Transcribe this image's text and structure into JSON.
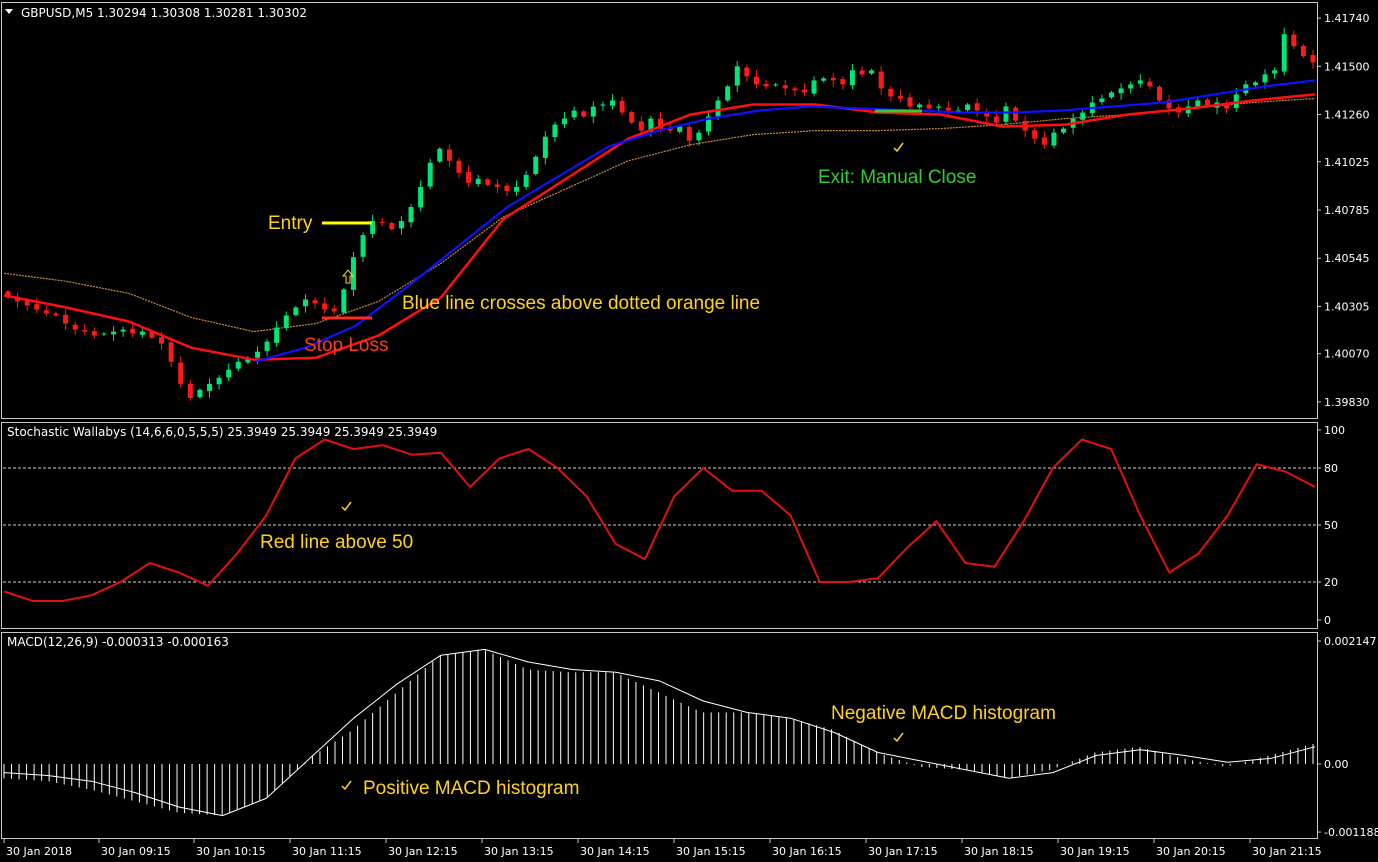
{
  "colors": {
    "background": "#000000",
    "frame": "#c8c8c8",
    "bull_candle": "#00e676",
    "bear_candle": "#ff1a1a",
    "ema_blue": "#1010ff",
    "ema_red": "#ff0f0f",
    "ema_orange_dotted": "#d08a3a",
    "stoch_line": "#e01010",
    "macd_hist": "#ffffff",
    "macd_signal": "#ffffff",
    "annotation_yellow": "#ffd21f",
    "annotation_red": "#ff3b1a",
    "annotation_green": "#33cc33"
  },
  "price_panel": {
    "header": "GBPUSD,M5  1.30294 1.30308 1.30281 1.30302",
    "menu_icon": "triangle-down-icon",
    "y_ticks": [
      "1.41740",
      "1.41500",
      "1.41260",
      "1.41025",
      "1.40785",
      "1.40545",
      "1.40305",
      "1.40070",
      "1.39830"
    ],
    "annotations": {
      "entry": "Entry",
      "cross": "Blue line crosses above dotted orange line",
      "stop": "Stop Loss",
      "exit": "Exit: Manual Close"
    }
  },
  "stoch_panel": {
    "header": "Stochastic Wallabys (14,6,6,0,5,5,5) 25.3949 25.3949 25.3949 25.3949",
    "y_ticks": [
      "100",
      "80",
      "50",
      "20",
      "0"
    ],
    "annotation": "Red line above 50"
  },
  "macd_panel": {
    "header": "MACD(12,26,9) -0.000313 -0.000163",
    "y_ticks": [
      "0.002147",
      "0.00",
      "-0.001188"
    ],
    "annotations": {
      "negative": "Negative MACD histogram",
      "positive": "Positive MACD histogram"
    }
  },
  "x_axis": {
    "labels": [
      "30 Jan 2018",
      "30 Jan 09:15",
      "30 Jan 10:15",
      "30 Jan 11:15",
      "30 Jan 12:15",
      "30 Jan 13:15",
      "30 Jan 14:15",
      "30 Jan 15:15",
      "30 Jan 16:15",
      "30 Jan 17:15",
      "30 Jan 18:15",
      "30 Jan 19:15",
      "30 Jan 20:15",
      "30 Jan 21:15"
    ]
  },
  "chart_data": [
    {
      "type": "candlestick",
      "title": "GBPUSD,M5  1.30294 1.30308 1.30281 1.30302",
      "note": "close prices estimated from candle bodies; bar index 0..136",
      "ylim": [
        1.3975,
        1.4182
      ],
      "closes": [
        1.4035,
        1.4033,
        1.4031,
        1.4029,
        1.4027,
        1.4026,
        1.4022,
        1.4019,
        1.4018,
        1.4016,
        1.4017,
        1.4018,
        1.4019,
        1.4017,
        1.4018,
        1.4015,
        1.4012,
        1.4003,
        1.3992,
        1.3985,
        1.3989,
        1.3992,
        1.3995,
        1.3999,
        1.4003,
        1.4005,
        1.4008,
        1.4013,
        1.402,
        1.4026,
        1.403,
        1.4034,
        1.4032,
        1.4029,
        1.4028,
        1.4039,
        1.4055,
        1.4066,
        1.4073,
        1.4072,
        1.4069,
        1.4073,
        1.408,
        1.409,
        1.4102,
        1.4109,
        1.4103,
        1.4097,
        1.4092,
        1.4094,
        1.4091,
        1.409,
        1.4088,
        1.409,
        1.4096,
        1.4105,
        1.4115,
        1.4121,
        1.4124,
        1.4128,
        1.4125,
        1.413,
        1.4131,
        1.4133,
        1.4127,
        1.4122,
        1.4118,
        1.4124,
        1.4119,
        1.4118,
        1.412,
        1.4113,
        1.4117,
        1.4125,
        1.4133,
        1.414,
        1.415,
        1.4145,
        1.4141,
        1.414,
        1.4141,
        1.4139,
        1.4138,
        1.4137,
        1.4143,
        1.4144,
        1.4143,
        1.4141,
        1.4148,
        1.4146,
        1.4148,
        1.4139,
        1.4135,
        1.4134,
        1.413,
        1.4131,
        1.4129,
        1.413,
        1.4128,
        1.4128,
        1.4131,
        1.4128,
        1.4125,
        1.4122,
        1.413,
        1.4123,
        1.4118,
        1.4114,
        1.4111,
        1.4117,
        1.4119,
        1.4124,
        1.4127,
        1.4132,
        1.4134,
        1.4137,
        1.4139,
        1.4141,
        1.4143,
        1.414,
        1.4133,
        1.4129,
        1.4127,
        1.413,
        1.4133,
        1.413,
        1.4132,
        1.4129,
        1.4136,
        1.4141,
        1.4142,
        1.4146,
        1.4148,
        1.4166,
        1.416,
        1.4155,
        1.4152
      ],
      "series": [
        {
          "name": "EMA blue",
          "values": [
            1.4003,
            1.401,
            1.4021,
            1.404,
            1.406,
            1.408,
            1.4095,
            1.411,
            1.4118,
            1.4124,
            1.4128,
            1.413,
            1.4129,
            1.4128,
            1.4127,
            1.4127,
            1.4128,
            1.413,
            1.4132,
            1.4136,
            1.414,
            1.4143
          ]
        },
        {
          "name": "EMA red",
          "values": [
            1.4036,
            1.403,
            1.4023,
            1.401,
            1.4004,
            1.4005,
            1.4016,
            1.4035,
            1.4074,
            1.4094,
            1.4114,
            1.4126,
            1.4131,
            1.4131,
            1.4127,
            1.4126,
            1.412,
            1.4121,
            1.4126,
            1.4129,
            1.4133,
            1.4136
          ]
        },
        {
          "name": "EMA orange dotted",
          "values": [
            1.4047,
            1.4043,
            1.4037,
            1.4025,
            1.4018,
            1.4022,
            1.4033,
            1.4052,
            1.4075,
            1.4089,
            1.4103,
            1.4111,
            1.4116,
            1.4118,
            1.4118,
            1.4119,
            1.4121,
            1.4124,
            1.4126,
            1.4129,
            1.4132,
            1.4134
          ]
        }
      ]
    },
    {
      "type": "line",
      "title": "Stochastic Wallabys (14,6,6,0,5,5,5) 25.3949 25.3949 25.3949 25.3949",
      "ylim": [
        0,
        100
      ],
      "levels": [
        80,
        50,
        20
      ],
      "series": [
        {
          "values": [
            15,
            10,
            10,
            13,
            20,
            30,
            25,
            18,
            35,
            55,
            85,
            95,
            90,
            92,
            87,
            88,
            70,
            85,
            90,
            80,
            65,
            40,
            32,
            65,
            80,
            68,
            68,
            55,
            20,
            20,
            22,
            38,
            52,
            30,
            28,
            52,
            80,
            95,
            90,
            55,
            25,
            35,
            55,
            82,
            78,
            70
          ]
        }
      ]
    },
    {
      "type": "bar",
      "title": "MACD(12,26,9) -0.000313 -0.000163",
      "ylim": [
        -0.001188,
        0.002147
      ],
      "note": "histogram = MACD main; line = signal",
      "series": [
        {
          "name": "histogram",
          "values": [
            -0.00025,
            -0.0003,
            -0.00045,
            -0.00065,
            -0.00085,
            -0.0009,
            -0.0006,
            0.0001,
            0.0006,
            0.00125,
            0.0019,
            0.002,
            0.00165,
            0.0016,
            0.0016,
            0.00125,
            0.0009,
            0.0009,
            0.0008,
            0.0006,
            0.0002,
            -5e-05,
            -0.0001,
            -0.00025,
            -0.0001,
            0.0002,
            0.0003,
            0.0001,
            -5e-05,
            0.00015,
            0.00035
          ]
        },
        {
          "name": "signal",
          "values": [
            -0.00015,
            -0.0002,
            -0.0003,
            -0.0005,
            -0.00075,
            -0.0009,
            -0.0006,
            0.0001,
            0.0008,
            0.0014,
            0.0019,
            0.002,
            0.00178,
            0.00165,
            0.0016,
            0.00145,
            0.0011,
            0.0009,
            0.0008,
            0.00055,
            0.0002,
            5e-05,
            -0.0001,
            -0.00025,
            -0.00015,
            0.00015,
            0.00025,
            0.00015,
            3e-05,
            0.0001,
            0.0003
          ]
        }
      ]
    }
  ]
}
